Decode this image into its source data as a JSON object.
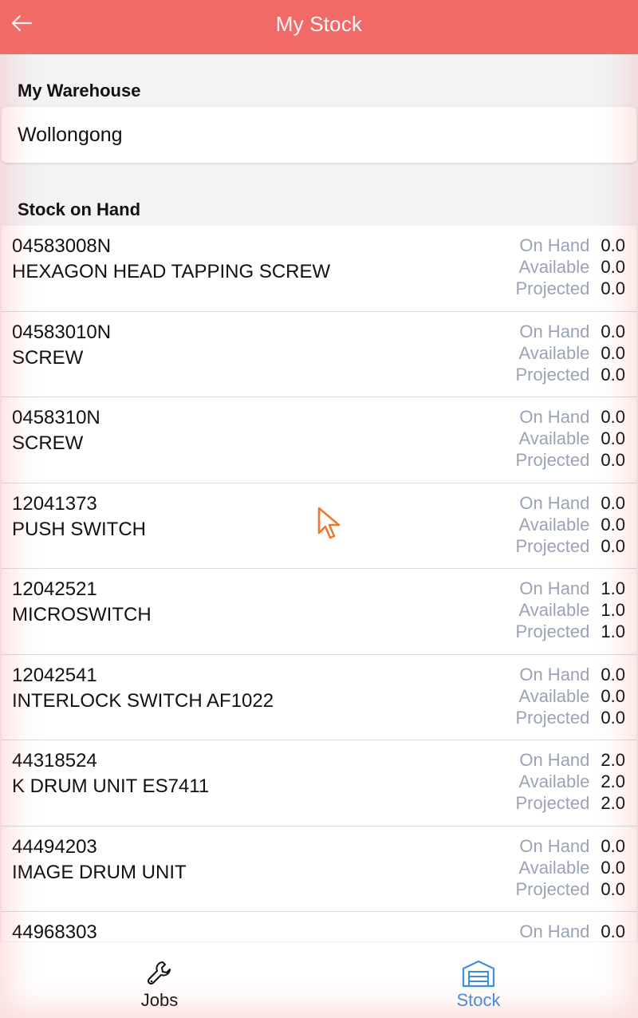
{
  "header": {
    "title": "My Stock",
    "back_icon": "arrow-left-icon"
  },
  "warehouse": {
    "label": "My Warehouse",
    "value": "Wollongong"
  },
  "stock": {
    "label": "Stock on Hand",
    "stat_labels": {
      "on_hand": "On Hand",
      "available": "Available",
      "projected": "Projected"
    },
    "items": [
      {
        "code": "04583008N",
        "description": "HEXAGON HEAD TAPPING SCREW",
        "on_hand": "0.0",
        "available": "0.0",
        "projected": "0.0"
      },
      {
        "code": "04583010N",
        "description": "SCREW",
        "on_hand": "0.0",
        "available": "0.0",
        "projected": "0.0"
      },
      {
        "code": "0458310N",
        "description": "SCREW",
        "on_hand": "0.0",
        "available": "0.0",
        "projected": "0.0"
      },
      {
        "code": "12041373",
        "description": "PUSH SWITCH",
        "on_hand": "0.0",
        "available": "0.0",
        "projected": "0.0"
      },
      {
        "code": "12042521",
        "description": "MICROSWITCH",
        "on_hand": "1.0",
        "available": "1.0",
        "projected": "1.0"
      },
      {
        "code": "12042541",
        "description": "INTERLOCK SWITCH AF1022",
        "on_hand": "0.0",
        "available": "0.0",
        "projected": "0.0"
      },
      {
        "code": "44318524",
        "description": "K DRUM UNIT ES7411",
        "on_hand": "2.0",
        "available": "2.0",
        "projected": "2.0"
      },
      {
        "code": "44494203",
        "description": "IMAGE DRUM UNIT",
        "on_hand": "0.0",
        "available": "0.0",
        "projected": "0.0"
      },
      {
        "code": "44968303",
        "description": "",
        "on_hand": "0.0",
        "available": "",
        "projected": ""
      }
    ]
  },
  "tabs": [
    {
      "label": "Jobs",
      "icon": "wrench-icon",
      "active": false
    },
    {
      "label": "Stock",
      "icon": "warehouse-icon",
      "active": true
    }
  ],
  "colors": {
    "header": "#f26b68",
    "active_tab": "#3d8fe0",
    "muted_label": "#9aa3b5"
  }
}
